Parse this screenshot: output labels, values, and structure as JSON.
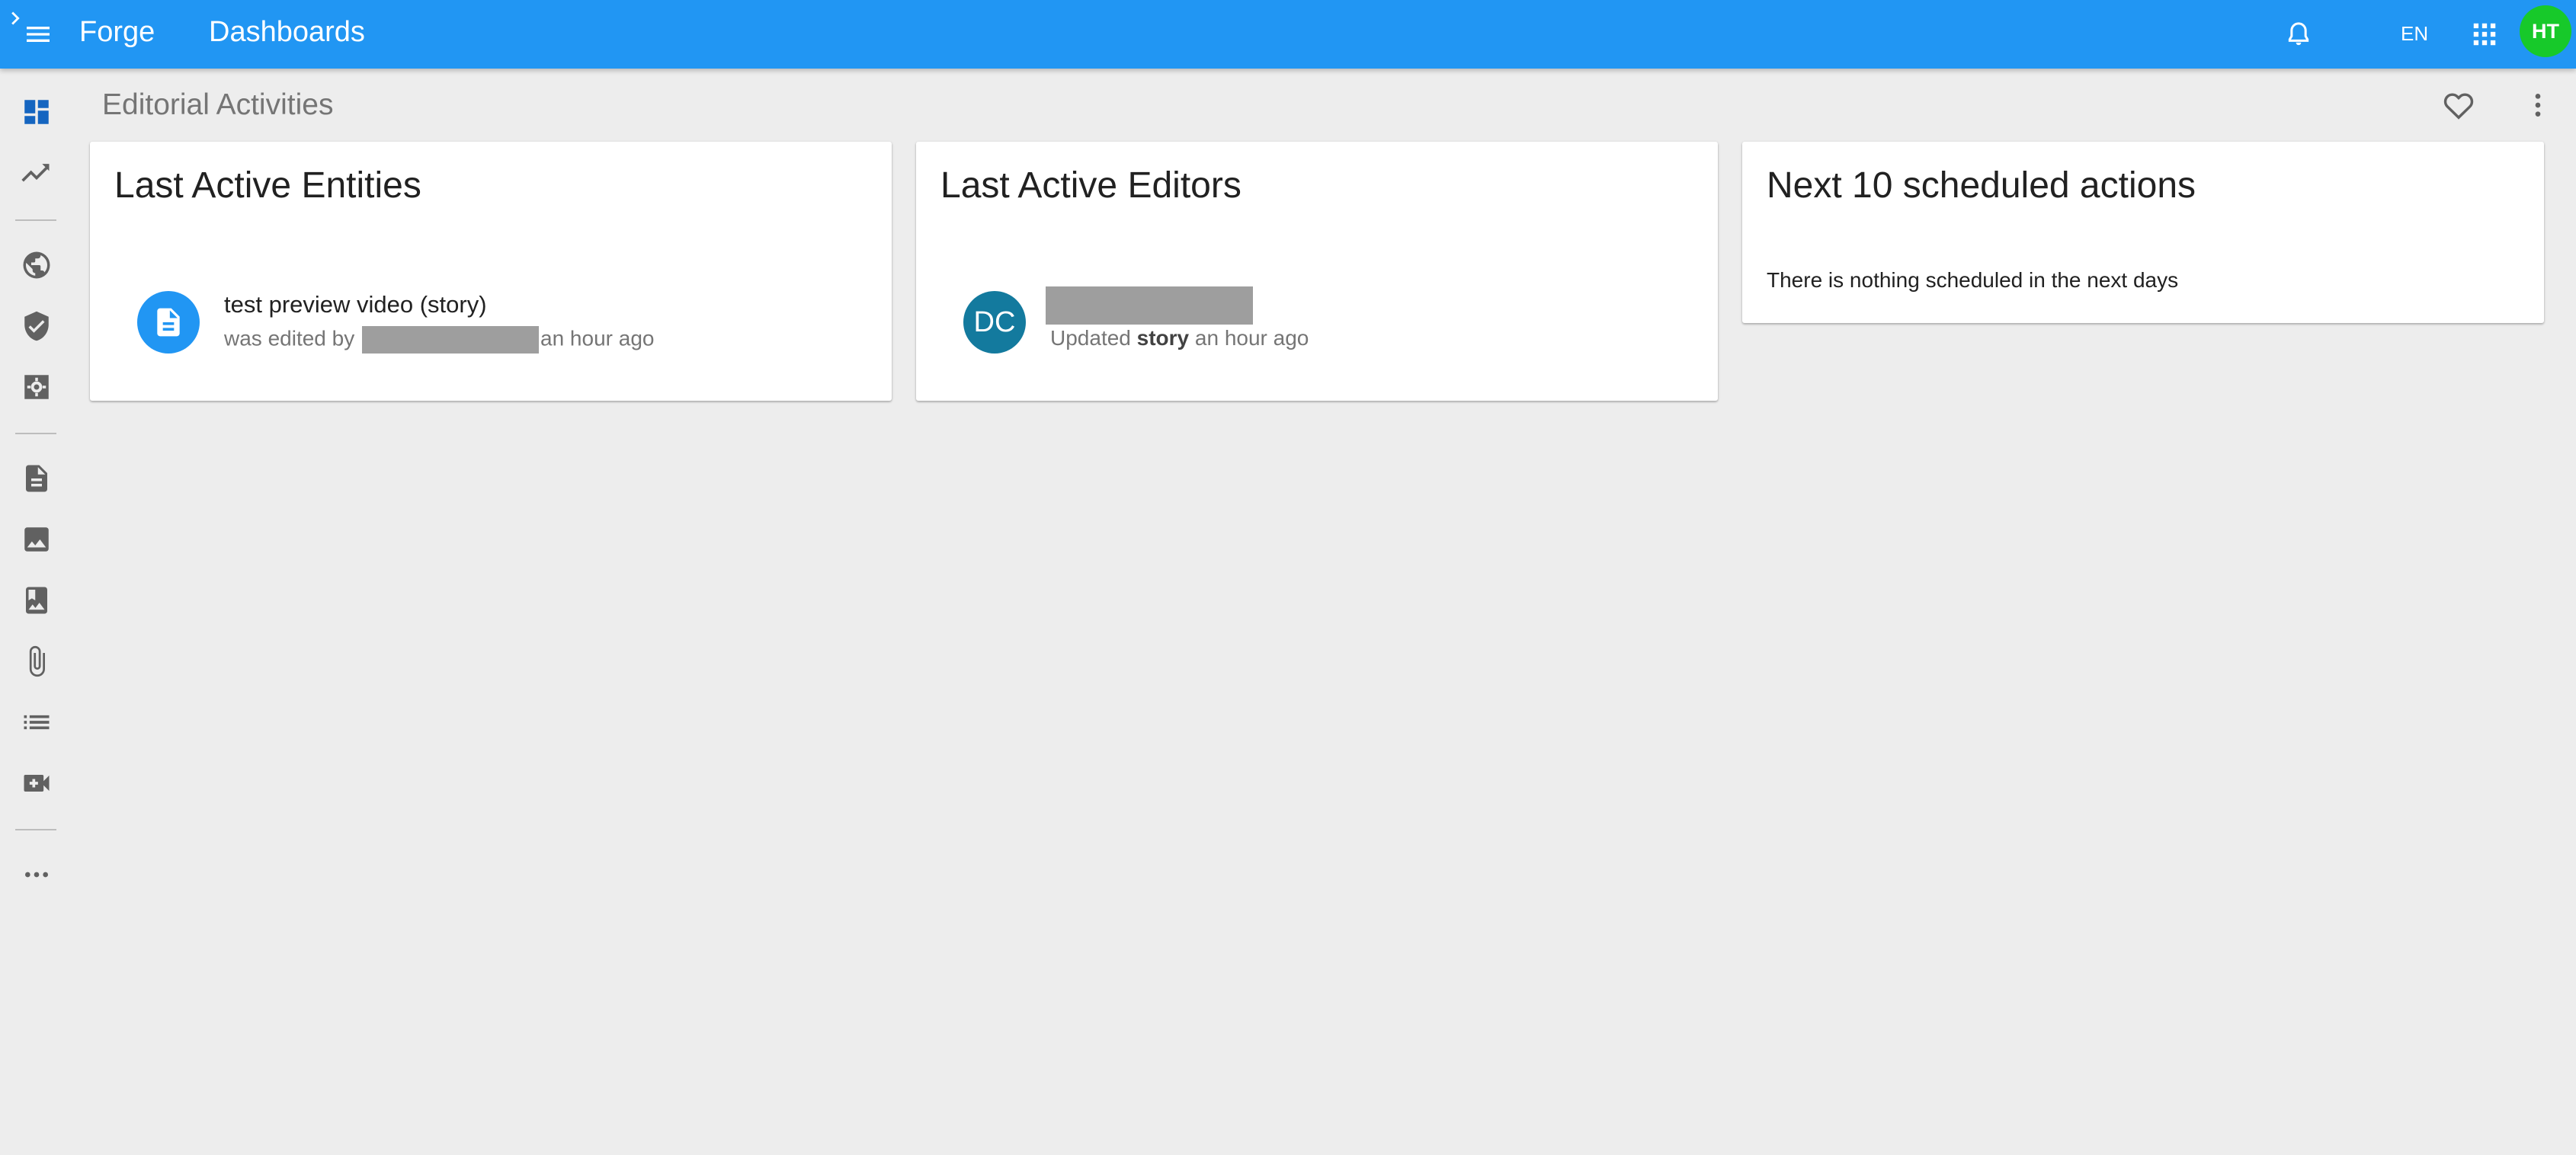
{
  "appbar": {
    "app_name": "Forge",
    "page_name": "Dashboards",
    "language": "EN",
    "user_initials": "HT",
    "brand_color": "#2196f3",
    "avatar_color": "#17c92a"
  },
  "rail": {
    "items": [
      {
        "icon": "dashboard-icon",
        "active": true
      },
      {
        "icon": "trending-icon"
      },
      {
        "icon": "globe-icon"
      },
      {
        "icon": "shield-check-icon"
      },
      {
        "icon": "settings-icon"
      },
      {
        "icon": "document-icon"
      },
      {
        "icon": "image-icon"
      },
      {
        "icon": "photo-album-icon"
      },
      {
        "icon": "attachment-icon"
      },
      {
        "icon": "list-icon"
      },
      {
        "icon": "video-add-icon"
      },
      {
        "icon": "more-horizontal-icon"
      }
    ]
  },
  "page": {
    "title": "Editorial Activities"
  },
  "cards": {
    "entities": {
      "title": "Last Active Entities",
      "item_title": "test preview video (story)",
      "edited_prefix": "was edited by",
      "edited_suffix": "an hour ago"
    },
    "editors": {
      "title": "Last Active Editors",
      "initials": "DC",
      "updated_prefix": "Updated",
      "updated_type": "story",
      "updated_suffix": "an hour ago"
    },
    "scheduled": {
      "title": "Next 10 scheduled actions",
      "empty_message": "There is nothing scheduled in the next days"
    }
  }
}
